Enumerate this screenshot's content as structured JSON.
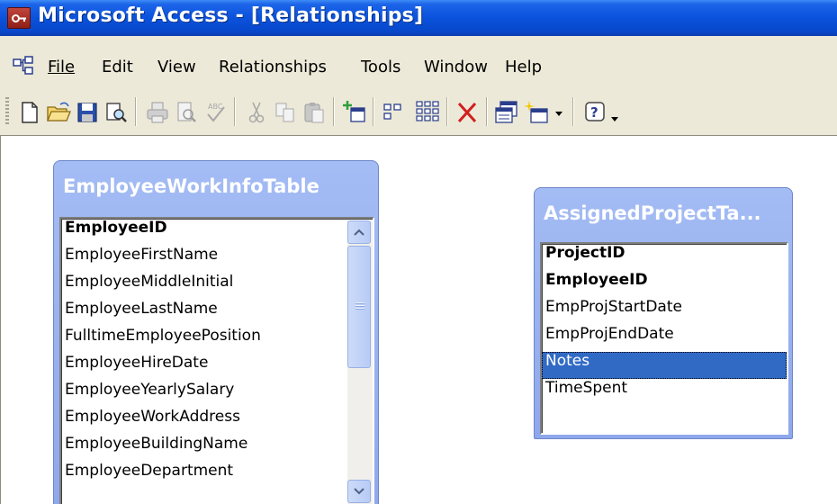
{
  "window": {
    "title": "Microsoft Access - [Relationships]"
  },
  "menu": {
    "items": [
      {
        "label": "File"
      },
      {
        "label": "Edit"
      },
      {
        "label": "View"
      },
      {
        "label": "Relationships"
      },
      {
        "label": "Tools"
      },
      {
        "label": "Window"
      },
      {
        "label": "Help"
      }
    ]
  },
  "toolbar": {
    "buttons": [
      {
        "icon": "new-document-icon"
      },
      {
        "icon": "open-folder-icon"
      },
      {
        "icon": "save-disk-icon"
      },
      {
        "icon": "file-search-icon"
      },
      {
        "icon": "print-icon"
      },
      {
        "icon": "print-preview-icon"
      },
      {
        "icon": "spelling-icon"
      },
      {
        "icon": "cut-icon"
      },
      {
        "icon": "copy-icon"
      },
      {
        "icon": "paste-icon"
      },
      {
        "icon": "show-table-icon"
      },
      {
        "icon": "show-direct-icon"
      },
      {
        "icon": "show-all-icon"
      },
      {
        "icon": "delete-icon"
      },
      {
        "icon": "database-window-icon"
      },
      {
        "icon": "new-object-icon"
      },
      {
        "icon": "help-icon"
      }
    ]
  },
  "tables": {
    "employee_work_info": {
      "caption": "EmployeeWorkInfoTable",
      "fields": [
        {
          "name": "EmployeeID",
          "key": true
        },
        {
          "name": "EmployeeFirstName",
          "key": false
        },
        {
          "name": "EmployeeMiddleInitial",
          "key": false
        },
        {
          "name": "EmployeeLastName",
          "key": false
        },
        {
          "name": "FulltimeEmployeePosition",
          "key": false
        },
        {
          "name": "EmployeeHireDate",
          "key": false
        },
        {
          "name": "EmployeeYearlySalary",
          "key": false
        },
        {
          "name": "EmployeeWorkAddress",
          "key": false
        },
        {
          "name": "EmployeeBuildingName",
          "key": false
        },
        {
          "name": "EmployeeDepartment",
          "key": false
        }
      ]
    },
    "assigned_project": {
      "caption": "AssignedProjectTa...",
      "fields": [
        {
          "name": "ProjectID",
          "key": true
        },
        {
          "name": "EmployeeID",
          "key": true
        },
        {
          "name": "EmpProjStartDate",
          "key": false
        },
        {
          "name": "EmpProjEndDate",
          "key": false
        },
        {
          "name": "Notes",
          "key": false,
          "selected": true
        },
        {
          "name": "TimeSpent",
          "key": false
        }
      ]
    }
  },
  "colors": {
    "titlebar": "#0a52dc",
    "table_caption_bg": "#a4bcf4",
    "selection": "#316ac5",
    "chrome": "#ece9d8"
  }
}
